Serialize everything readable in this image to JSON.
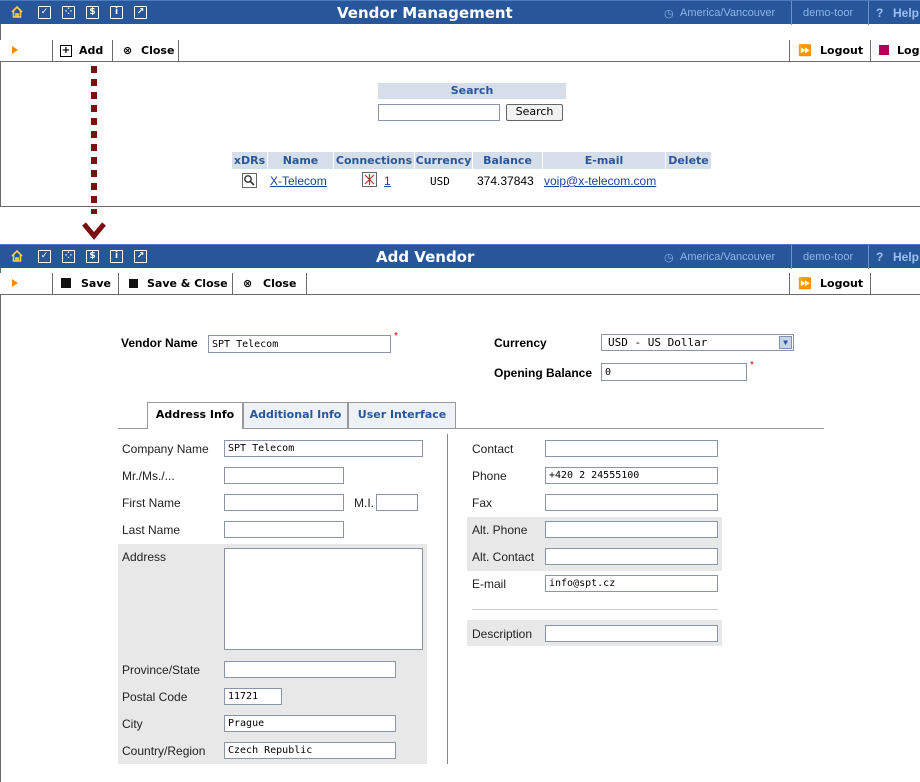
{
  "top": {
    "title": "Vendor Management",
    "timezone": "America/Vancouver",
    "user": "demo-toor",
    "help": "Help",
    "toolbar": {
      "add": "Add",
      "close": "Close",
      "logout": "Logout",
      "log": "Log"
    },
    "search": {
      "label": "Search",
      "value": "",
      "button": "Search"
    },
    "table": {
      "headers": [
        "xDRs",
        "Name",
        "Connections",
        "Currency",
        "Balance",
        "E-mail",
        "Delete"
      ],
      "rows": [
        {
          "name": "X-Telecom",
          "connections": "1",
          "currency": "USD",
          "balance": "374.37843",
          "email": "voip@x-telecom.com"
        }
      ]
    }
  },
  "bottom": {
    "title": "Add Vendor",
    "timezone": "America/Vancouver",
    "user": "demo-toor",
    "help": "Help",
    "toolbar": {
      "save": "Save",
      "save_close": "Save & Close",
      "close": "Close",
      "logout": "Logout"
    },
    "vendor_name": {
      "label": "Vendor Name",
      "value": "SPT Telecom"
    },
    "currency": {
      "label": "Currency",
      "value": "USD - US Dollar"
    },
    "opening_balance": {
      "label": "Opening Balance",
      "value": "0"
    },
    "tabs": [
      "Address Info",
      "Additional Info",
      "User Interface"
    ],
    "left_fields": {
      "company_name": {
        "label": "Company Name",
        "value": "SPT Telecom"
      },
      "salutation": {
        "label": "Mr./Ms./...",
        "value": ""
      },
      "first_name": {
        "label": "First Name",
        "value": ""
      },
      "mi": {
        "label": "M.I.",
        "value": ""
      },
      "last_name": {
        "label": "Last Name",
        "value": ""
      },
      "address": {
        "label": "Address",
        "value": ""
      },
      "province": {
        "label": "Province/State",
        "value": ""
      },
      "postal_code": {
        "label": "Postal Code",
        "value": "11721"
      },
      "city": {
        "label": "City",
        "value": "Prague"
      },
      "country": {
        "label": "Country/Region",
        "value": "Czech Republic"
      }
    },
    "right_fields": {
      "contact": {
        "label": "Contact",
        "value": ""
      },
      "phone": {
        "label": "Phone",
        "value": "+420 2 24555100"
      },
      "fax": {
        "label": "Fax",
        "value": ""
      },
      "alt_phone": {
        "label": "Alt. Phone",
        "value": ""
      },
      "alt_contact": {
        "label": "Alt. Contact",
        "value": ""
      },
      "email": {
        "label": "E-mail",
        "value": "info@spt.cz"
      },
      "description": {
        "label": "Description",
        "value": ""
      }
    }
  },
  "colors": {
    "titlebar": "#27579a",
    "accent_orange": "#f08c00",
    "connector": "#7a1010",
    "label_band": "#d6dee9"
  }
}
